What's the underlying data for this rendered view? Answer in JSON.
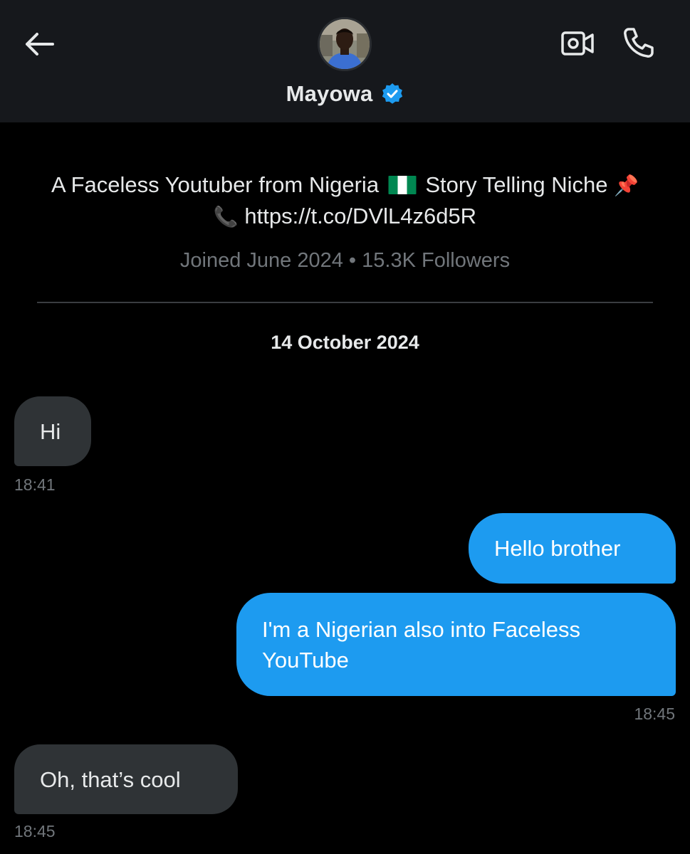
{
  "header": {
    "name": "Mayowa",
    "back_icon": "arrow-left-icon",
    "video_icon": "video-camera-icon",
    "call_icon": "phone-icon",
    "verified_icon": "verified-badge-icon",
    "verified_color": "#1d9bf0"
  },
  "profile": {
    "bio_part1": "A Faceless Youtuber from Nigeria",
    "bio_part2": "Story Telling Niche",
    "bio_pin": "📌",
    "bio_phone": "📞",
    "bio_link": "https://t.co/DVlL4z6d5R",
    "meta": "Joined June 2024 • 15.3K Followers"
  },
  "date_separator": "14 October 2024",
  "messages": [
    {
      "direction": "incoming",
      "text": "Hi",
      "time": "18:41"
    },
    {
      "direction": "outgoing",
      "text": "Hello brother",
      "time": ""
    },
    {
      "direction": "outgoing",
      "text": "I'm a Nigerian also into Faceless YouTube",
      "time": "18:45"
    },
    {
      "direction": "incoming",
      "text": "Oh, that’s cool",
      "time": "18:45"
    }
  ],
  "colors": {
    "background": "#000000",
    "header": "#16181c",
    "incoming_bubble": "#2f3336",
    "outgoing_bubble": "#1d9bf0",
    "muted_text": "#71767b"
  }
}
